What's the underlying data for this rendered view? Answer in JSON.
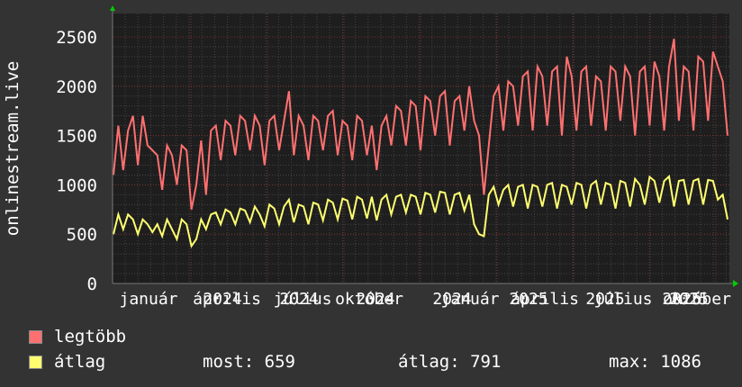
{
  "chart_data": {
    "type": "line",
    "ylabel": "onlinestream.live",
    "ylim": [
      0,
      2600
    ],
    "yticks": [
      "0",
      "500",
      "1000",
      "1500",
      "2000",
      "2500"
    ],
    "xticks": [
      "január",
      "2024",
      "április",
      "2024",
      "július",
      "2024",
      "október",
      "2024",
      "január",
      "2025",
      "április",
      "2025",
      "július",
      "2025",
      "október",
      "2025"
    ],
    "grid": true,
    "colors": {
      "background": "#333333",
      "plot": "#1e1e1e",
      "max": "#ff7070",
      "avg": "#ffff70",
      "axis_arrow": "#00cc00"
    },
    "series": [
      {
        "name": "legtöbb",
        "color": "#ff7070",
        "values": [
          1100,
          1600,
          1150,
          1550,
          1700,
          1200,
          1700,
          1400,
          1350,
          1300,
          950,
          1400,
          1300,
          1000,
          1400,
          1350,
          750,
          1000,
          1450,
          900,
          1550,
          1600,
          1250,
          1650,
          1600,
          1300,
          1700,
          1650,
          1350,
          1700,
          1600,
          1200,
          1650,
          1700,
          1350,
          1650,
          1950,
          1300,
          1700,
          1600,
          1250,
          1700,
          1650,
          1350,
          1700,
          1750,
          1300,
          1650,
          1600,
          1250,
          1700,
          1650,
          1300,
          1600,
          1150,
          1600,
          1700,
          1400,
          1800,
          1750,
          1400,
          1850,
          1800,
          1350,
          1900,
          1850,
          1500,
          1900,
          1950,
          1400,
          1850,
          1900,
          1550,
          2000,
          1650,
          1500,
          900,
          1400,
          1900,
          2000,
          1550,
          2050,
          2000,
          1600,
          2100,
          2150,
          1550,
          2200,
          2100,
          1600,
          2150,
          2200,
          1500,
          2300,
          2100,
          1550,
          2150,
          2200,
          1600,
          2100,
          2050,
          1550,
          2200,
          2150,
          1650,
          2200,
          2100,
          1500,
          2150,
          2200,
          1600,
          2250,
          2100,
          1550,
          2200,
          2480,
          1650,
          2200,
          2150,
          1550,
          2300,
          2250,
          1650,
          2350,
          2200,
          2050,
          1500
        ]
      },
      {
        "name": "átlag",
        "color": "#ffff70",
        "values": [
          500,
          700,
          550,
          700,
          650,
          500,
          650,
          600,
          520,
          600,
          480,
          650,
          550,
          450,
          650,
          600,
          380,
          450,
          650,
          550,
          700,
          720,
          600,
          750,
          720,
          600,
          760,
          740,
          620,
          780,
          700,
          580,
          800,
          760,
          600,
          780,
          850,
          620,
          800,
          780,
          600,
          820,
          800,
          640,
          850,
          820,
          650,
          860,
          840,
          650,
          880,
          850,
          660,
          880,
          640,
          850,
          900,
          700,
          880,
          900,
          720,
          900,
          880,
          700,
          920,
          900,
          720,
          930,
          920,
          700,
          900,
          920,
          740,
          900,
          600,
          500,
          480,
          900,
          980,
          800,
          950,
          1000,
          780,
          980,
          1000,
          760,
          1000,
          980,
          780,
          1000,
          1020,
          760,
          1000,
          980,
          800,
          1020,
          1000,
          760,
          1000,
          1040,
          800,
          1020,
          1000,
          760,
          1040,
          1020,
          780,
          1060,
          1000,
          800,
          1080,
          1040,
          820,
          1040,
          1086,
          780,
          1040,
          1050,
          800,
          1040,
          1060,
          800,
          1050,
          1040,
          850,
          900,
          650
        ]
      }
    ]
  },
  "legend": {
    "max_label": "legtöbb",
    "avg_label": "átlag",
    "now": "most: 659",
    "average": "átlag: 791",
    "maximum": "max: 1086"
  }
}
